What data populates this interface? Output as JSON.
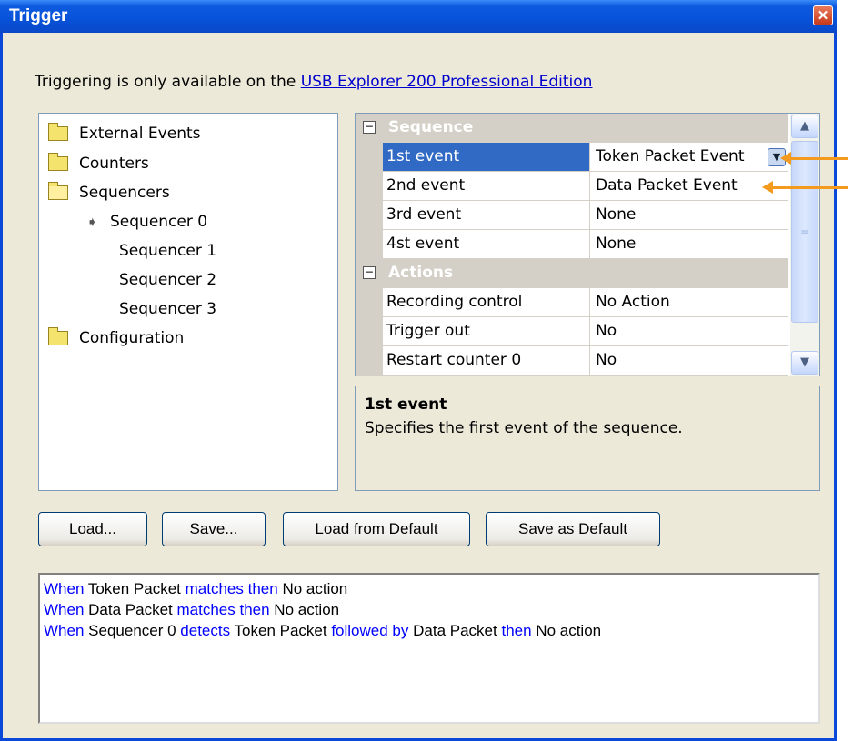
{
  "window": {
    "title": "Trigger",
    "close_icon": "✕"
  },
  "notice": {
    "prefix": "Triggering is only available on the ",
    "link": "USB Explorer 200 Professional Edition"
  },
  "tree": {
    "items": [
      {
        "label": "External Events",
        "icon": "folder-icon"
      },
      {
        "label": "Counters",
        "icon": "folder-icon"
      },
      {
        "label": "Sequencers",
        "icon": "folder-open-icon"
      },
      {
        "label": "Sequencer 0",
        "icon": "arrow-right-icon"
      },
      {
        "label": "Sequencer 1"
      },
      {
        "label": "Sequencer 2"
      },
      {
        "label": "Sequencer 3"
      },
      {
        "label": "Configuration",
        "icon": "folder-icon"
      }
    ]
  },
  "grid": {
    "cat_sequence": "Sequence",
    "cat_actions": "Actions",
    "rows": [
      {
        "name": "1st event",
        "value": "Token Packet Event"
      },
      {
        "name": "2nd event",
        "value": "Data Packet Event"
      },
      {
        "name": "3rd event",
        "value": "None"
      },
      {
        "name": "4st event",
        "value": "None"
      },
      {
        "name": "Recording control",
        "value": "No Action"
      },
      {
        "name": "Trigger out",
        "value": "No"
      },
      {
        "name": "Restart counter 0",
        "value": "No"
      }
    ],
    "toggle_symbol": "−"
  },
  "description": {
    "title": "1st event",
    "text": "Specifies the first event of the sequence."
  },
  "buttons": {
    "load": "Load...",
    "save": "Save...",
    "load_default": "Load from Default",
    "save_default": "Save as Default"
  },
  "log": {
    "l1": {
      "w1": "When",
      "a": "Token Packet",
      "w2": "matches then",
      "b": "No action"
    },
    "l2": {
      "w1": "When",
      "a": "Data Packet",
      "w2": "matches then",
      "b": "No action"
    },
    "l3": {
      "w1": "When",
      "a": "Sequencer 0",
      "w2": "detects",
      "b": "Token Packet",
      "w3": "followed by",
      "c": "Data Packet",
      "w4": "then",
      "d": "No action"
    }
  },
  "colors": {
    "accent_arrow": "#f39a1f",
    "keyword": "#0000ff",
    "selection": "#316ac5"
  }
}
